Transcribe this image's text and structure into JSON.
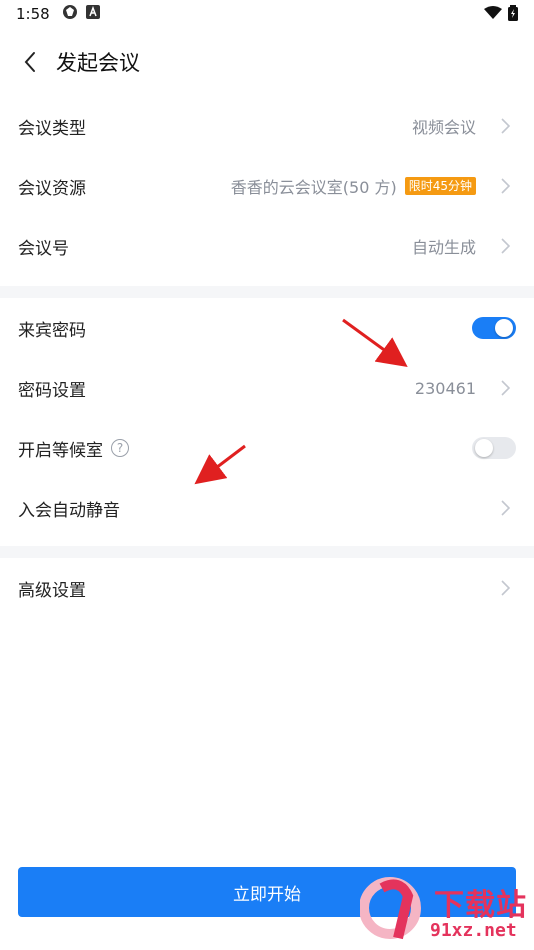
{
  "status_bar": {
    "time": "1:58"
  },
  "header": {
    "title": "发起会议"
  },
  "section1": {
    "rows": [
      {
        "label": "会议类型",
        "value": "视频会议"
      },
      {
        "label": "会议资源",
        "value": "香香的云会议室(50 方)",
        "badge": "限时45分钟"
      },
      {
        "label": "会议号",
        "value": "自动生成"
      }
    ]
  },
  "section2": {
    "guest_password": {
      "label": "来宾密码",
      "enabled": true
    },
    "password_setting": {
      "label": "密码设置",
      "value": "230461"
    },
    "waiting_room": {
      "label": "开启等候室",
      "help": "?",
      "enabled": false
    },
    "auto_mute": {
      "label": "入会自动静音"
    }
  },
  "section3": {
    "advanced": {
      "label": "高级设置"
    }
  },
  "footer": {
    "start_label": "立即开始"
  },
  "watermark": {
    "cn": "下载站",
    "en": "91xz.net"
  },
  "colors": {
    "accent": "#1a7ef6",
    "badge": "#f59a12",
    "divider_bg": "#f5f6f8",
    "annotation": "#e02020"
  }
}
